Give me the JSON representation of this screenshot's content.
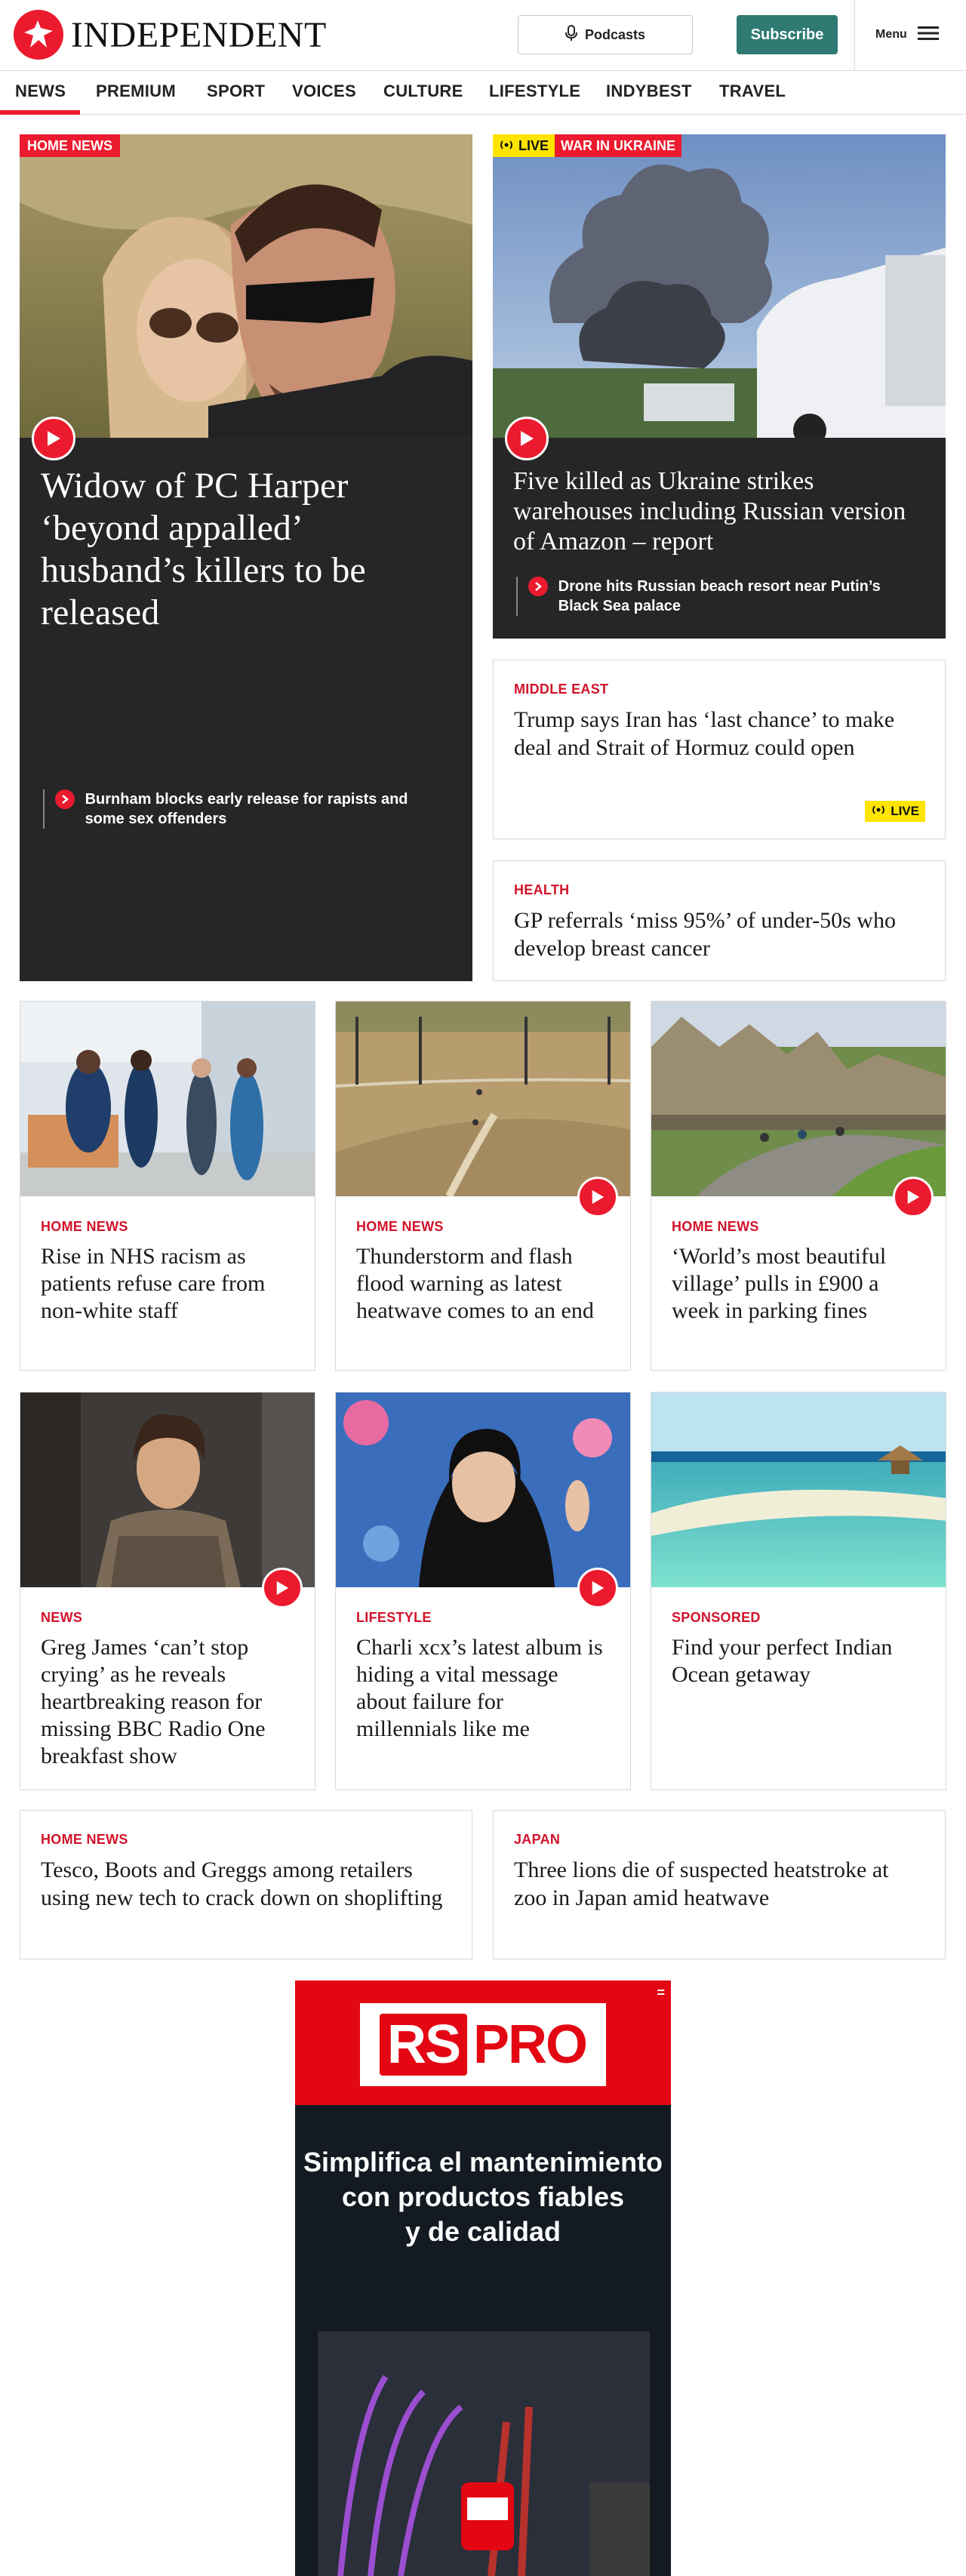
{
  "header": {
    "logo_text": "INDEPENDENT",
    "podcasts_label": "Podcasts",
    "subscribe_label": "Subscribe",
    "menu_label": "Menu"
  },
  "nav": {
    "items": [
      "NEWS",
      "PREMIUM",
      "SPORT",
      "VOICES",
      "CULTURE",
      "LIFESTYLE",
      "INDYBEST",
      "TRAVEL"
    ],
    "active": "NEWS"
  },
  "hero_left": {
    "tag": "HOME NEWS",
    "headline": "Widow of PC Harper ‘beyond appalled’ husband’s killers to be released",
    "related": "Burnham blocks early release for rapists and some sex offenders"
  },
  "hero_right": {
    "live_label": "LIVE",
    "tag": "WAR IN UKRAINE",
    "headline": "Five killed as Ukraine strikes warehouses including Russian version of Amazon – report",
    "related": "Drone hits Russian beach resort near Putin’s Black Sea palace"
  },
  "side_stories": [
    {
      "tag": "MIDDLE EAST",
      "headline": "Trump says Iran has ‘last chance’ to make deal and Strait of Hormuz could open",
      "live_label": "LIVE"
    },
    {
      "tag": "HEALTH",
      "headline": "GP referrals ‘miss 95%’ of under-50s who develop breast cancer"
    }
  ],
  "grid_row1": [
    {
      "tag": "HOME NEWS",
      "headline": "Rise in NHS racism as patients refuse care from non-white staff"
    },
    {
      "tag": "HOME NEWS",
      "headline": "Thunderstorm and flash flood warning as latest heatwave comes to an end"
    },
    {
      "tag": "HOME NEWS",
      "headline": "‘World’s most beautiful village’ pulls in £900 a week in parking fines"
    }
  ],
  "grid_row2": [
    {
      "tag": "NEWS",
      "headline": "Greg James ‘can’t stop crying’ as he reveals heartbreaking reason for missing BBC Radio One breakfast show"
    },
    {
      "tag": "LIFESTYLE",
      "headline": "Charli xcx’s latest album is hiding a vital message about failure for millennials like me"
    },
    {
      "tag": "SPONSORED",
      "headline": "Find your perfect Indian Ocean getaway"
    }
  ],
  "text_row": [
    {
      "tag": "HOME NEWS",
      "headline": "Tesco, Boots and Greggs among retailers using new tech to crack down on shoplifting"
    },
    {
      "tag": "JAPAN",
      "headline": "Three lions die of suspected heatstroke at zoo in Japan amid heatwave"
    }
  ],
  "ad": {
    "brand_rs": "RS",
    "brand_pro": "PRO",
    "line1": "Simplifica el mantenimiento",
    "line2": "con productos fiables",
    "line3": "y de calidad",
    "close": "="
  },
  "colors": {
    "brand_red": "#ec1a2e",
    "subscribe_teal": "#2f7a73",
    "live_yellow": "#ffe400",
    "hero_bg": "#262626"
  }
}
